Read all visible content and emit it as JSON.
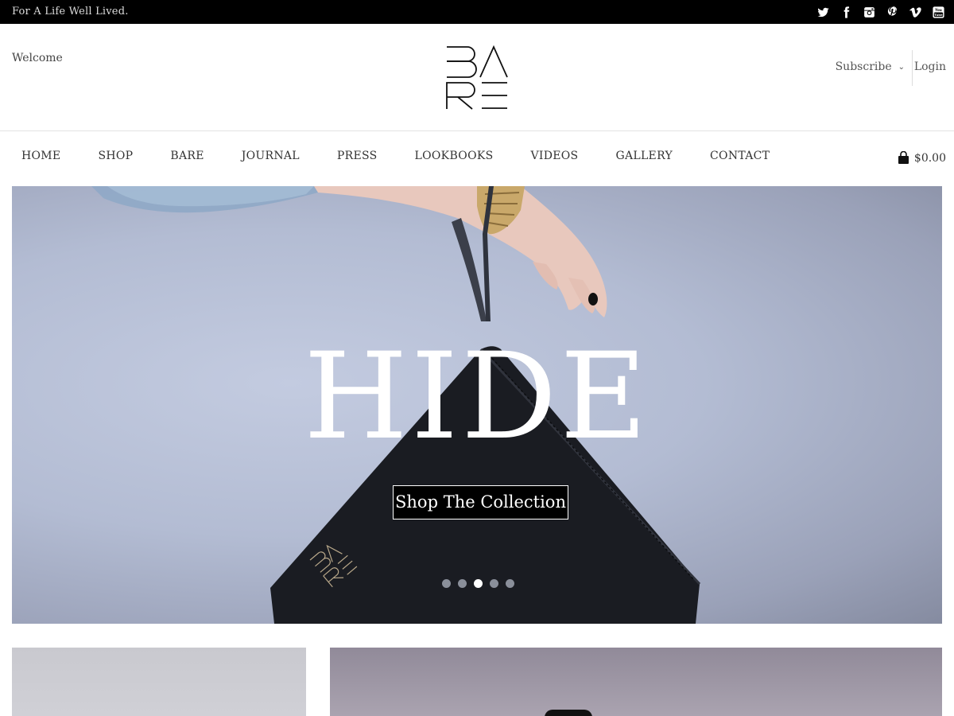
{
  "topbar": {
    "tagline": "For A Life Well Lived.",
    "social_icons": [
      "twitter-icon",
      "facebook-icon",
      "instagram-icon",
      "pinterest-icon",
      "vimeo-icon",
      "youtube-icon"
    ]
  },
  "header": {
    "welcome": "Welcome",
    "logo_letters": [
      "B",
      "A",
      "R",
      "E"
    ],
    "subscribe_label": "Subscribe",
    "login_label": "Login"
  },
  "nav": {
    "items": [
      "HOME",
      "SHOP",
      "BARE",
      "JOURNAL",
      "PRESS",
      "LOOKBOOKS",
      "VIDEOS",
      "GALLERY",
      "CONTACT"
    ],
    "cart_total": "$0.00"
  },
  "hero": {
    "title": "HIDE",
    "button_label": "Shop The Collection",
    "slide_count": 5,
    "active_slide": 3
  },
  "colors": {
    "topbar_bg": "#000000",
    "hero_bg": "#b3bcd3",
    "button_bg": "#000000"
  }
}
